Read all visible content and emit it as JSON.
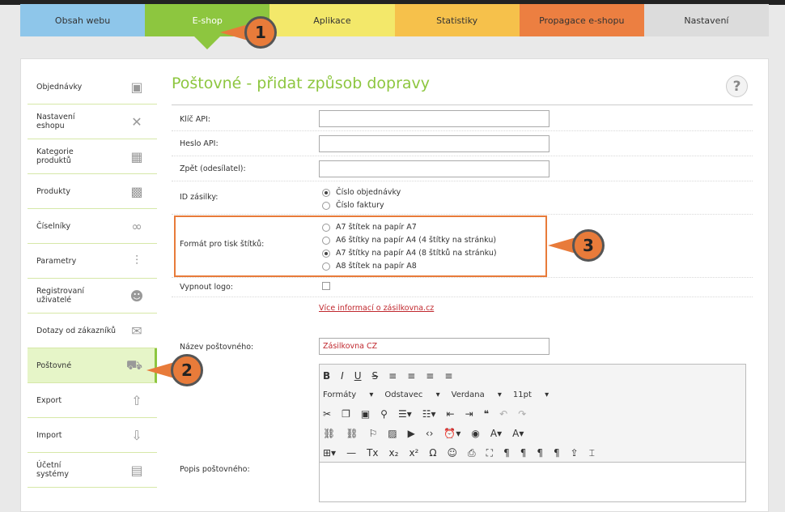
{
  "tabs": [
    {
      "label": "Obsah webu",
      "color": "#8ec6ea"
    },
    {
      "label": "E-shop",
      "color": "#8dc63f"
    },
    {
      "label": "Aplikace",
      "color": "#f3e86a"
    },
    {
      "label": "Statistiky",
      "color": "#f6c14b"
    },
    {
      "label": "Propagace e-shopu",
      "color": "#ec7f41"
    },
    {
      "label": "Nastavení",
      "color": "#dcdcdc"
    }
  ],
  "sidebar": [
    {
      "label": "Objednávky",
      "icon": "clipboard-icon"
    },
    {
      "label": "Nastavení eshopu",
      "icon": "tools-icon"
    },
    {
      "label": "Kategorie produktů",
      "icon": "boxes-icon"
    },
    {
      "label": "Produkty",
      "icon": "cubes-icon"
    },
    {
      "label": "Číselníky",
      "icon": "binoculars-icon"
    },
    {
      "label": "Parametry",
      "icon": "sliders-icon"
    },
    {
      "label": "Registrovaní uživatelé",
      "icon": "users-icon"
    },
    {
      "label": "Dotazy od zákazníků",
      "icon": "chat-icon"
    },
    {
      "label": "Poštovné",
      "icon": "truck-icon"
    },
    {
      "label": "Export",
      "icon": "upload-icon"
    },
    {
      "label": "Import",
      "icon": "download-icon"
    },
    {
      "label": "Účetní systémy",
      "icon": "calculator-icon"
    }
  ],
  "page": {
    "title": "Poštovné - přidat způsob dopravy",
    "help": "?"
  },
  "form": {
    "api_key_label": "Klíč API:",
    "api_pass_label": "Heslo API:",
    "sender_label": "Zpět (odesílatel):",
    "id_label": "ID zásilky:",
    "id_opts": [
      "Číslo objednávky",
      "Číslo faktury"
    ],
    "format_label": "Formát pro tisk štítků:",
    "format_opts": [
      "A7 štítek na papír A7",
      "A6 štítky na papír A4 (4 štítky na stránku)",
      "A7 štítky na papír A4 (8 štítků na stránku)",
      "A8 štítek na papír A8"
    ],
    "logo_label": "Vypnout logo:",
    "more_link": "Více informací o zásilkovna.cz",
    "name_label": "Název poštovného:",
    "name_value": "Zásilkovna CZ",
    "desc_label": "Popis poštovného:"
  },
  "editor": {
    "formats": "Formáty",
    "paragraph": "Odstavec",
    "font": "Verdana",
    "size": "11pt"
  },
  "callouts": [
    "1",
    "2",
    "3"
  ]
}
